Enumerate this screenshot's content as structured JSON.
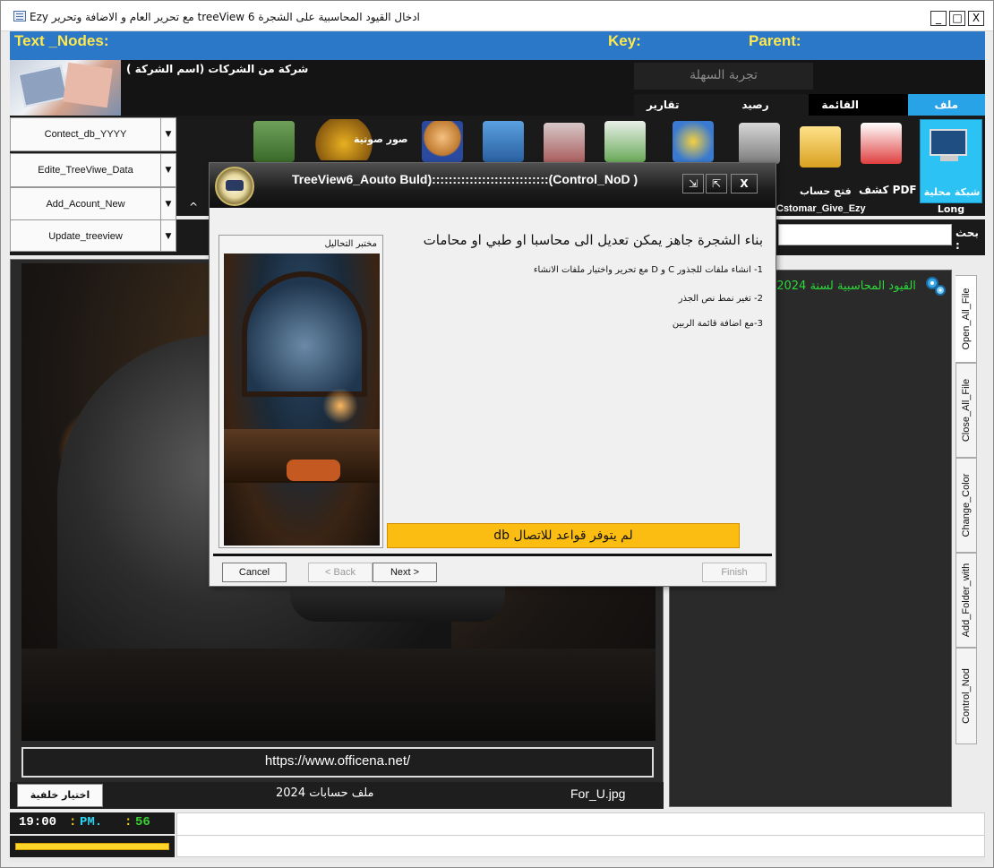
{
  "window": {
    "title": "Ezy مع تحرير العام و الاضافة وتحرير treeView 6 ادخال القيود المحاسبية على الشجرة",
    "minimize": "_",
    "maximize": "□",
    "close": "X"
  },
  "bluebar": {
    "text_nodes": "Text _Nodes:",
    "key": "Key:",
    "parent": "Parent:"
  },
  "ribbon": {
    "company": "شركة من الشركات (اسم الشركة )",
    "tajruba": "تجربة السهلة",
    "tabs": [
      "ملف",
      "القائمة الرنيسية",
      "رصيد الخزنة",
      "تقارير ومراسلة"
    ]
  },
  "left_buttons": [
    "Contect_db_YYYY",
    "Edite_TreeViwe_Data",
    "Add_Acount_New",
    "Update_treeview"
  ],
  "toolbar": {
    "caret": "^",
    "sound_images": "صور صوتية",
    "network": "شبكة محلية",
    "long": "Long",
    "pdf": "كشف PDF",
    "open_account": "فتح حساب",
    "cstomar": "Cstomar_Give_Ezy"
  },
  "search": {
    "label": "بحث :"
  },
  "preview": {
    "url": "https://www.officena.net/",
    "bg_button": "اختيار خلفية",
    "file_label": "ملف حسابات 2024",
    "image_label": "For_U.jpg"
  },
  "tree": {
    "item": "القيود المحاسبية لسنة 2024 ("
  },
  "vtabs": [
    "Open_All_File",
    "Close_All_File",
    "Change_Color",
    "Add_Folder_with",
    "Control_Nod"
  ],
  "clock": {
    "time": "19:00",
    "sep": ":",
    "ampm": "PM.",
    "seconds": "56"
  },
  "progress": {
    "value": 1.0
  },
  "dialog": {
    "title": "TreeView6_Aouto Buld)::::::::::::::::::::::::::::(Control_NoD )",
    "ctl_restore": "⇲",
    "ctl_max": "⇱",
    "ctl_close": "X",
    "lab_label": "مختبر التحاليل",
    "heading": "بناء الشجرة جاهز يمكن تعديل الى محاسبا او طبي او محامات",
    "lines": [
      "1- انشاء ملفات للجذور C و D مع تحرير واختيار ملفات الانشاء",
      "2- تغير نمط نص الجذر",
      "3-مع اضافة قائمة الربين"
    ],
    "warning": "لم يتوفر قواعد للاتصال db",
    "buttons": {
      "cancel": "Cancel",
      "back": "< Back",
      "next": "Next >",
      "finish": "Finish"
    }
  },
  "colors": {
    "accent_blue": "#2b77c8",
    "active_tab": "#29a3e8",
    "warning": "#fbbd12",
    "tree_green": "#2cd93a"
  }
}
